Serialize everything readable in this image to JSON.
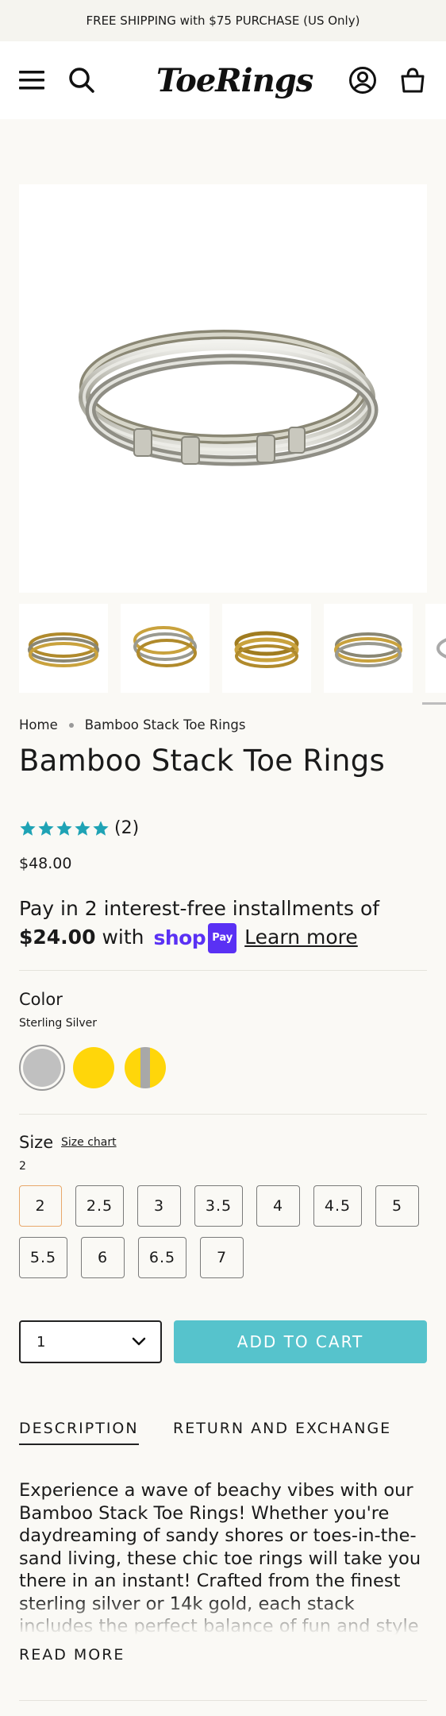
{
  "announcement": "FREE SHIPPING with $75 PURCHASE (US Only)",
  "header": {
    "logo_text": "ToeRings"
  },
  "breadcrumb": {
    "home": "Home",
    "current": "Bamboo Stack Toe Rings"
  },
  "product": {
    "title": "Bamboo Stack Toe Rings",
    "rating": 5,
    "review_count": "(2)",
    "price": "$48.00",
    "installments": {
      "prefix": "Pay in 2 interest-free installments of",
      "amount": "$24.00",
      "with": "with",
      "shop_word": "shop",
      "shop_pay": "Pay",
      "learn_more": "Learn more"
    }
  },
  "color": {
    "label": "Color",
    "selected": "Sterling Silver",
    "swatches": [
      {
        "name": "Sterling Silver",
        "color": "#c0c0c0"
      },
      {
        "name": "14k Gold",
        "color": "#ffd60a"
      },
      {
        "name": "Two Tone",
        "color": "#ffd60a",
        "accent": "#a8a8a8"
      }
    ]
  },
  "size": {
    "label": "Size",
    "chart_link": "Size chart",
    "selected": "2",
    "options": [
      "2",
      "2.5",
      "3",
      "3.5",
      "4",
      "4.5",
      "5",
      "5.5",
      "6",
      "6.5",
      "7"
    ]
  },
  "cart": {
    "quantity": "1",
    "add_to_cart": "ADD TO CART"
  },
  "tabs": [
    "DESCRIPTION",
    "RETURN AND EXCHANGE"
  ],
  "description": "Experience a wave of beachy vibes with our Bamboo Stack Toe Rings! Whether you're daydreaming of sandy shores or toes-in-the-sand living, these chic toe rings will take you there in an instant! Crafted from the finest sterling silver or 14k gold, each stack includes the perfect balance of fun and style",
  "read_more": "READ MORE",
  "colors": {
    "accent": "#56c3cc",
    "star": "#1fa3b5",
    "shop_pay": "#5a31f4",
    "selected_border": "#e8a86b"
  }
}
